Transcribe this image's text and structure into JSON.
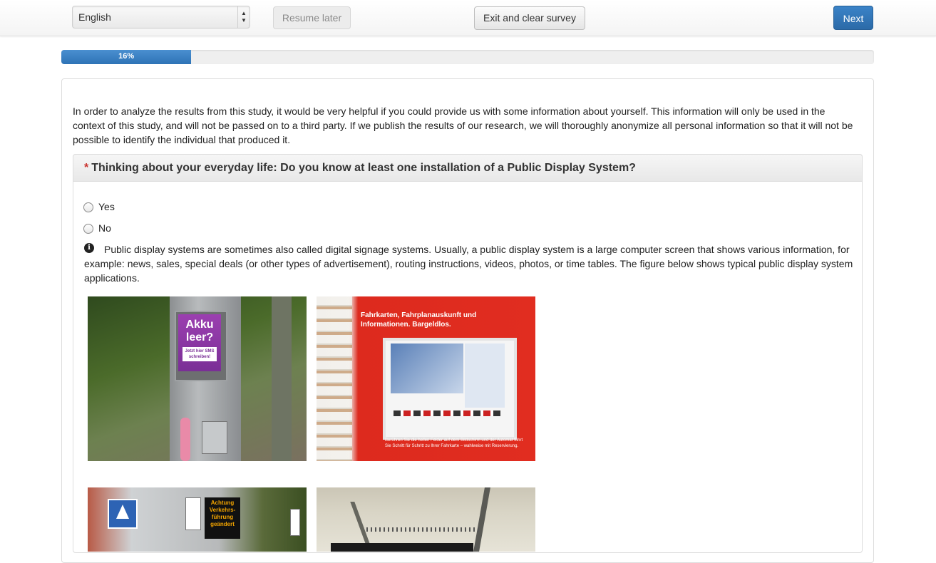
{
  "navbar": {
    "language": {
      "selected": "English"
    },
    "resume_label": "Resume later",
    "exit_label": "Exit and clear survey",
    "next_label": "Next"
  },
  "progress": {
    "value": 16,
    "label": "16%"
  },
  "intro_text": "In order to analyze the results from this study, it would be very helpful if you could provide us with some information about yourself. This information will only be used in the context of this study, and will not be passed on to a third party. If we publish the results of our research, we will thoroughly anonymize all personal information so that it will not be possible to identify the individual that produced it.",
  "question": {
    "required_mark": "*",
    "text": "Thinking about your everyday life: Do you know at least one installation of a Public Display System?",
    "options": [
      {
        "label": "Yes"
      },
      {
        "label": "No"
      }
    ],
    "info_icon": "info-circle-icon",
    "help_text": "Public display systems are sometimes also called digital signage systems. Usually, a public display system is a large computer screen that shows various information, for example: news, sales, special deals (or other types of advertisement), routing instructions, videos, photos, or time tables. The figure below shows typical public display system applications."
  },
  "photos": {
    "payphone": {
      "display_text": "Akku leer?",
      "display_sub": "Jetzt hier SMS schreiben!"
    },
    "ticket_machine": {
      "headline": "Fahrkarten, Fahrplanauskunft und Informationen. Bargeldlos.",
      "footer": "Berühren Sie die hellen Felder auf dem Bildschirm und der Automat führt Sie Schritt für Schritt zu Ihrer Fahrkarte – wahlweise mit Reservierung."
    },
    "street": {
      "led_text": "Achtung Verkehrs-führung geändert"
    }
  },
  "colors": {
    "primary": "#2e73b6",
    "required": "#c9302c"
  }
}
